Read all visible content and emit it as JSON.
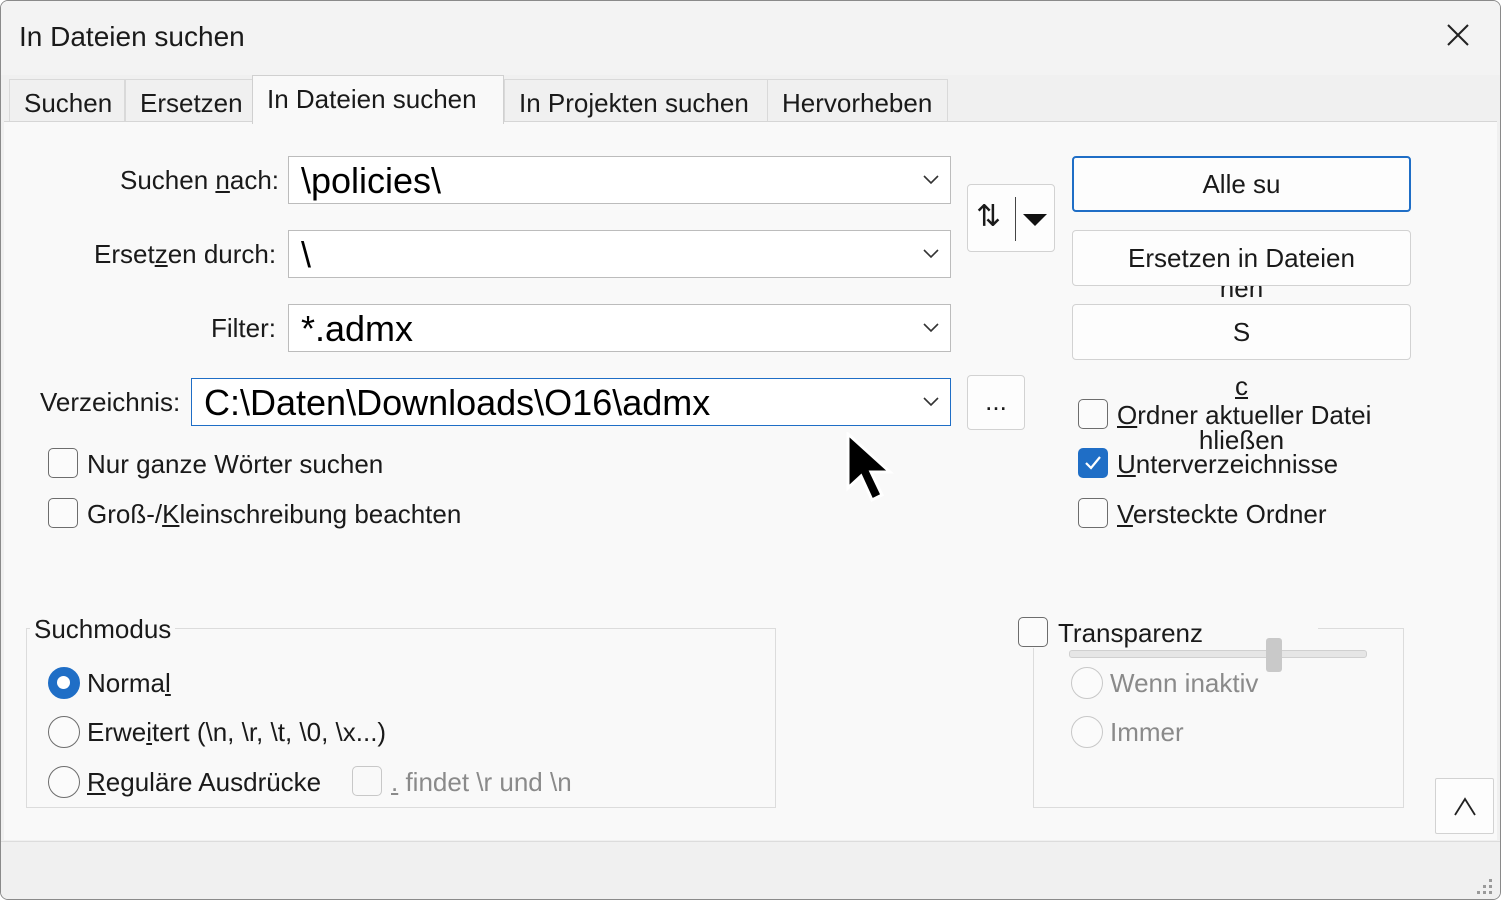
{
  "window": {
    "title": "In Dateien suchen"
  },
  "tabs": [
    {
      "label": "Suchen"
    },
    {
      "label": "Ersetzen"
    },
    {
      "label": "In Dateien suchen"
    },
    {
      "label": "In Projekten suchen"
    },
    {
      "label": "Hervorheben"
    }
  ],
  "active_tab": "In Dateien suchen",
  "fields": {
    "search": {
      "label_a": "Suchen ",
      "label_u": "n",
      "label_b": "ach:",
      "value": "\\policies\\"
    },
    "replace": {
      "label_a": "Erset",
      "label_u": "z",
      "label_b": "en durch:",
      "value": "\\"
    },
    "filter": {
      "label": "Filter:",
      "value": "*.admx"
    },
    "directory": {
      "label": "Verzeichnis:",
      "value": "C:\\Daten\\Downloads\\O16\\admx"
    }
  },
  "swap_glyph": "⇅",
  "browse_label": "...",
  "buttons": {
    "find_all": {
      "a": "Alle su",
      "u": "c",
      "b": "hen"
    },
    "replace_in_files": {
      "label": "Ersetzen in Dateien"
    },
    "close": {
      "a": "S",
      "u": "c",
      "b": "hließen"
    }
  },
  "options_left": [
    {
      "a": "Nur ",
      "u": "g",
      "b": "anze Wörter suchen",
      "checked": false
    },
    {
      "a": "Groß-/",
      "u": "K",
      "b": "leinschreibung beachten",
      "checked": false
    }
  ],
  "options_right": [
    {
      "a": "",
      "u": "O",
      "b": "rdner aktueller Datei",
      "checked": false
    },
    {
      "a": "",
      "u": "U",
      "b": "nterverzeichnisse",
      "checked": true
    },
    {
      "a": "",
      "u": "V",
      "b": "ersteckte Ordner",
      "checked": false
    }
  ],
  "search_mode": {
    "title": "Suchmodus",
    "options": [
      {
        "a": "Norma",
        "u": "l",
        "b": "",
        "checked": true
      },
      {
        "a": "Erwe",
        "u": "i",
        "b": "tert (\\n, \\r, \\t, \\0, \\x...)",
        "checked": false
      },
      {
        "a": "",
        "u": "R",
        "b": "eguläre Ausdrücke",
        "checked": false
      }
    ],
    "dot_option": {
      "u": ".",
      "b": " findet \\r und \\n",
      "checked": false,
      "enabled": false
    }
  },
  "transparency": {
    "label": "Transparenz",
    "checked": false,
    "options": [
      {
        "label": "Wenn inaktiv",
        "enabled": false
      },
      {
        "label": "Immer",
        "enabled": false
      }
    ],
    "slider_level": 0.7
  },
  "collapse_glyph": "^",
  "colors": {
    "accent": "#1f6ec6",
    "disabled_text": "#8a8a8a"
  }
}
